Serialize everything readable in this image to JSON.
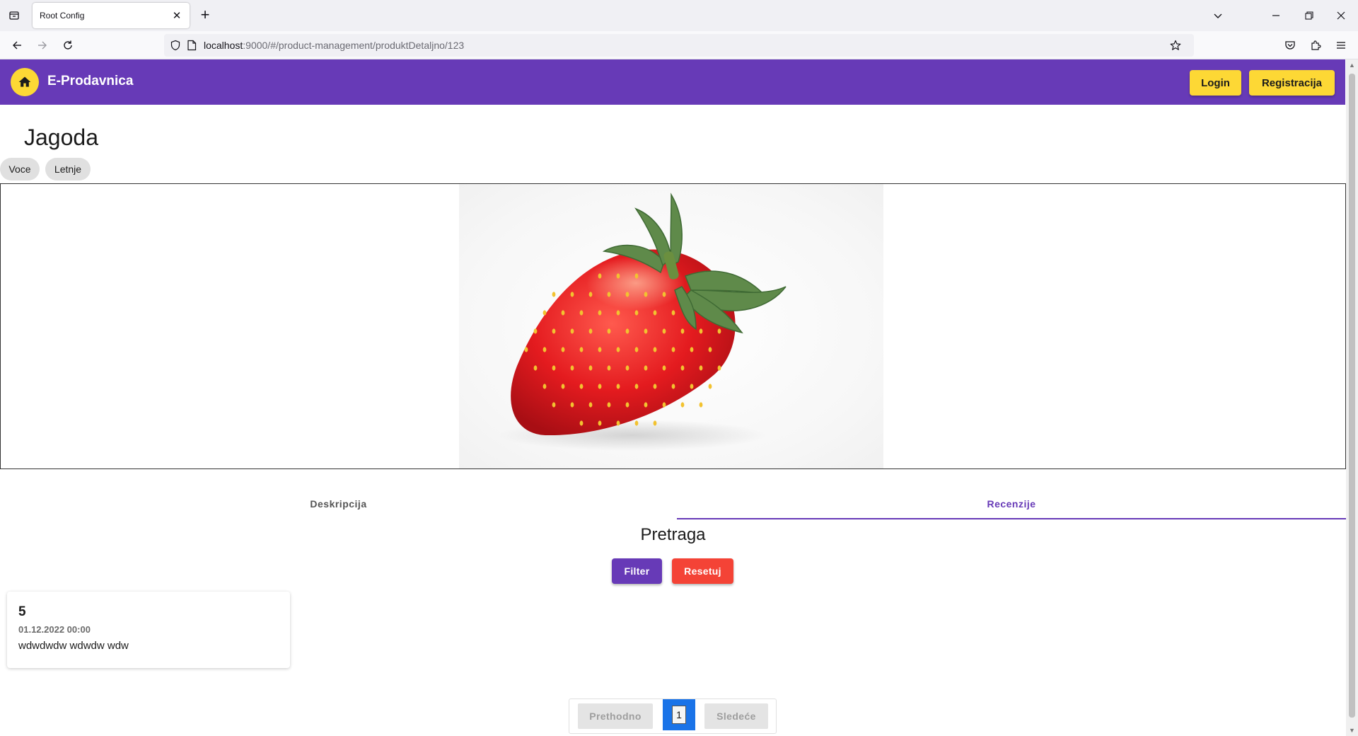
{
  "browser": {
    "tab_title": "Root Config",
    "url_host": "localhost",
    "url_path": ":9000/#/product-management/produktDetaljno/123"
  },
  "header": {
    "brand": "E-Prodavnica",
    "login_label": "Login",
    "register_label": "Registracija"
  },
  "product": {
    "title": "Jagoda",
    "tags": [
      "Voce",
      "Letnje"
    ],
    "image_alt": "strawberry"
  },
  "tabs": {
    "description_label": "Deskripcija",
    "reviews_label": "Recenzije",
    "active": "Recenzije"
  },
  "search": {
    "title": "Pretraga",
    "filter_label": "Filter",
    "reset_label": "Resetuj"
  },
  "reviews": [
    {
      "rating": "5",
      "date": "01.12.2022 00:00",
      "text": "wdwdwdw wdwdw wdw"
    }
  ],
  "pagination": {
    "prev_label": "Prethodno",
    "current_page": "1",
    "next_label": "Sledeće"
  },
  "colors": {
    "primary": "#673ab7",
    "accent": "#fdd835",
    "danger": "#f44336",
    "page_active": "#1a73e8"
  }
}
